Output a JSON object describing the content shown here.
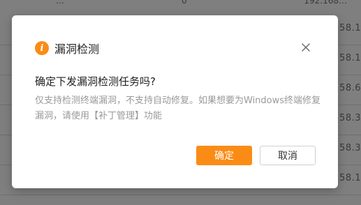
{
  "background": {
    "top_texts": [
      "…",
      "0",
      "192.168…"
    ],
    "right_cells": [
      "58.1",
      "58.1",
      "58.6",
      "58.3",
      "58.3",
      "58.1"
    ]
  },
  "dialog": {
    "title": "漏洞检测",
    "icon": "warning-icon",
    "question": "确定下发漏洞检测任务吗?",
    "description": "仅支持检测终端漏洞，不支持自动修复。如果想要为Windows终端修复漏洞，请使用【补丁管理】功能",
    "ok_label": "确定",
    "cancel_label": "取消"
  },
  "colors": {
    "accent": "#fa8c16"
  }
}
